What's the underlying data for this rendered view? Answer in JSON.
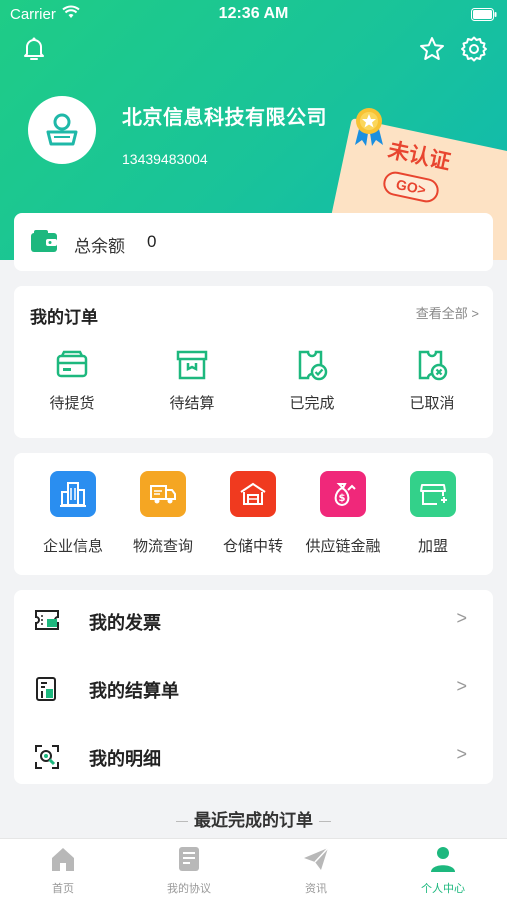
{
  "status": {
    "carrier": "Carrier",
    "time": "12:36 AM"
  },
  "profile": {
    "company": "北京信息科技有限公司",
    "phone": "13439483004",
    "verify_label": "未认证",
    "go_label": "GO>"
  },
  "balance": {
    "label": "总余额",
    "value": "0"
  },
  "orders": {
    "title": "我的订单",
    "view_all": "查看全部 >",
    "items": [
      {
        "label": "待提货",
        "icon": "card-icon"
      },
      {
        "label": "待结算",
        "icon": "box-icon"
      },
      {
        "label": "已完成",
        "icon": "ticket-check-icon"
      },
      {
        "label": "已取消",
        "icon": "ticket-cancel-icon"
      }
    ]
  },
  "services": [
    {
      "label": "企业信息",
      "color": "#2a8ef0",
      "icon": "building-icon"
    },
    {
      "label": "物流查询",
      "color": "#f5a623",
      "icon": "truck-icon"
    },
    {
      "label": "仓储中转",
      "color": "#f03a1f",
      "icon": "warehouse-icon"
    },
    {
      "label": "供应链金融",
      "color": "#f0287a",
      "icon": "money-bag-icon"
    },
    {
      "label": "加盟",
      "color": "#33d18a",
      "icon": "shop-icon"
    }
  ],
  "menu": [
    {
      "label": "我的发票",
      "arrow": ">",
      "icon": "invoice-icon"
    },
    {
      "label": "我的结算单",
      "arrow": ">",
      "icon": "statement-icon"
    },
    {
      "label": "我的明细",
      "arrow": ">",
      "icon": "detail-icon"
    }
  ],
  "recent_title": "最近完成的订单",
  "tabs": [
    {
      "label": "首页",
      "icon": "home-icon"
    },
    {
      "label": "我的协议",
      "icon": "agreement-icon"
    },
    {
      "label": "资讯",
      "icon": "paper-plane-icon"
    },
    {
      "label": "个人中心",
      "icon": "person-icon",
      "active": true
    }
  ],
  "colors": {
    "accent": "#1db87e",
    "header_start": "#1fcc86",
    "header_end": "#10b9b0",
    "warning": "#e8452f"
  }
}
